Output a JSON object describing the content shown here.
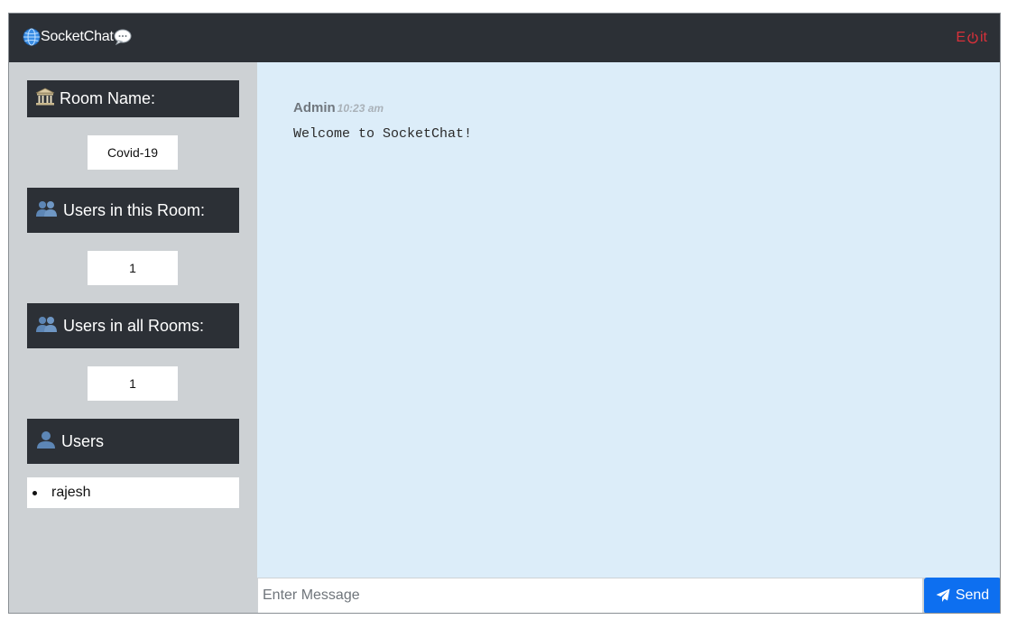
{
  "navbar": {
    "brand_text": "SocketChat",
    "brand_icons": [
      "globe-icon",
      "speech-bubble-icon"
    ],
    "exit_label_start": "E",
    "exit_label_end": "it",
    "exit_icon": "power-icon",
    "exit_color": "#d7303a"
  },
  "sidebar": {
    "room_header": "Room Name:",
    "room_icon": "classical-building-icon",
    "room_name": "Covid-19",
    "room_users_header": "Users in this Room:",
    "room_users_count": "1",
    "all_users_header": "Users in all Rooms:",
    "all_users_count": "1",
    "users_header": "Users",
    "users_icon": "bust-icon",
    "users": [
      "rajesh"
    ]
  },
  "chat": {
    "messages": [
      {
        "author": "Admin",
        "time": "10:23 am",
        "text": "Welcome to SocketChat!"
      }
    ]
  },
  "composer": {
    "placeholder": "Enter Message",
    "send_label": "Send",
    "send_icon": "paper-plane-icon",
    "send_color": "#0d6ff0"
  },
  "colors": {
    "dark": "#2c3036",
    "sidebar_bg": "#cdd1d4",
    "chat_bg": "#dcedf9"
  }
}
